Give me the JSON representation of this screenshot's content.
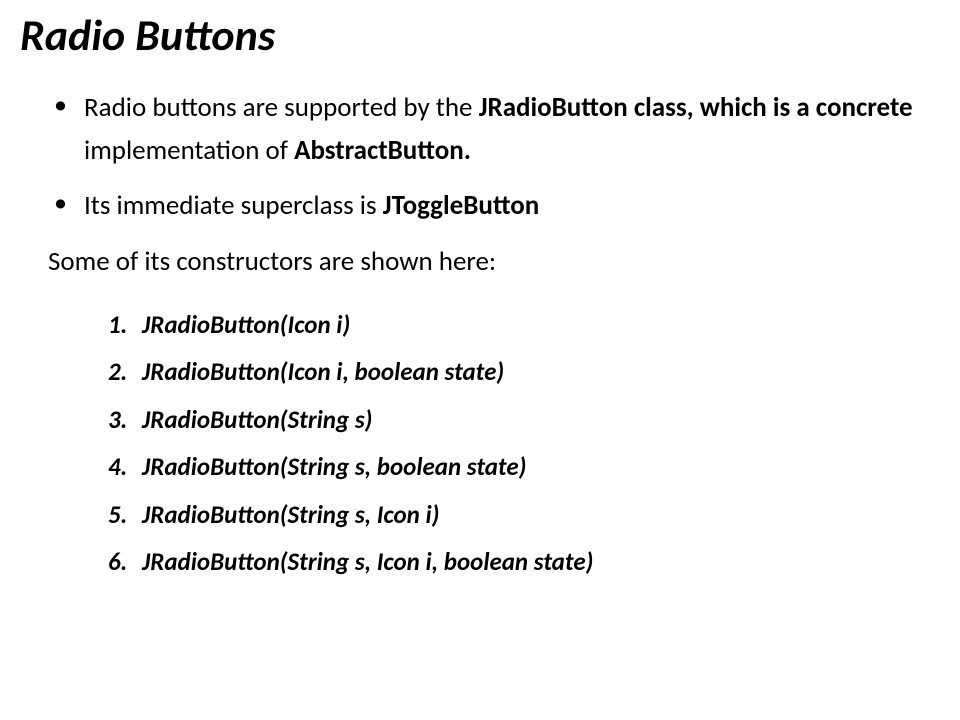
{
  "title": "Radio Buttons",
  "bullets": {
    "item1_pre": "Radio buttons are supported by the ",
    "item1_bold1": "JRadioButton class, which is a concrete",
    "item1_mid": " implementation of ",
    "item1_bold2": "AbstractButton.",
    "item2_pre": " Its immediate superclass is ",
    "item2_bold": "JToggleButton"
  },
  "intro": "Some of its constructors are shown here:",
  "constructors": {
    "n1": "1.",
    "c1": "JRadioButton(Icon i)",
    "n2": "2.",
    "c2": "JRadioButton(Icon i, boolean state)",
    "n3": "3.",
    "c3": "JRadioButton(String s)",
    "n4": "4.",
    "c4": "JRadioButton(String s, boolean state)",
    "n5": "5.",
    "c5": "JRadioButton(String s, Icon i)",
    "n6": "6.",
    "c6": "JRadioButton(String s, Icon i, boolean state)"
  }
}
